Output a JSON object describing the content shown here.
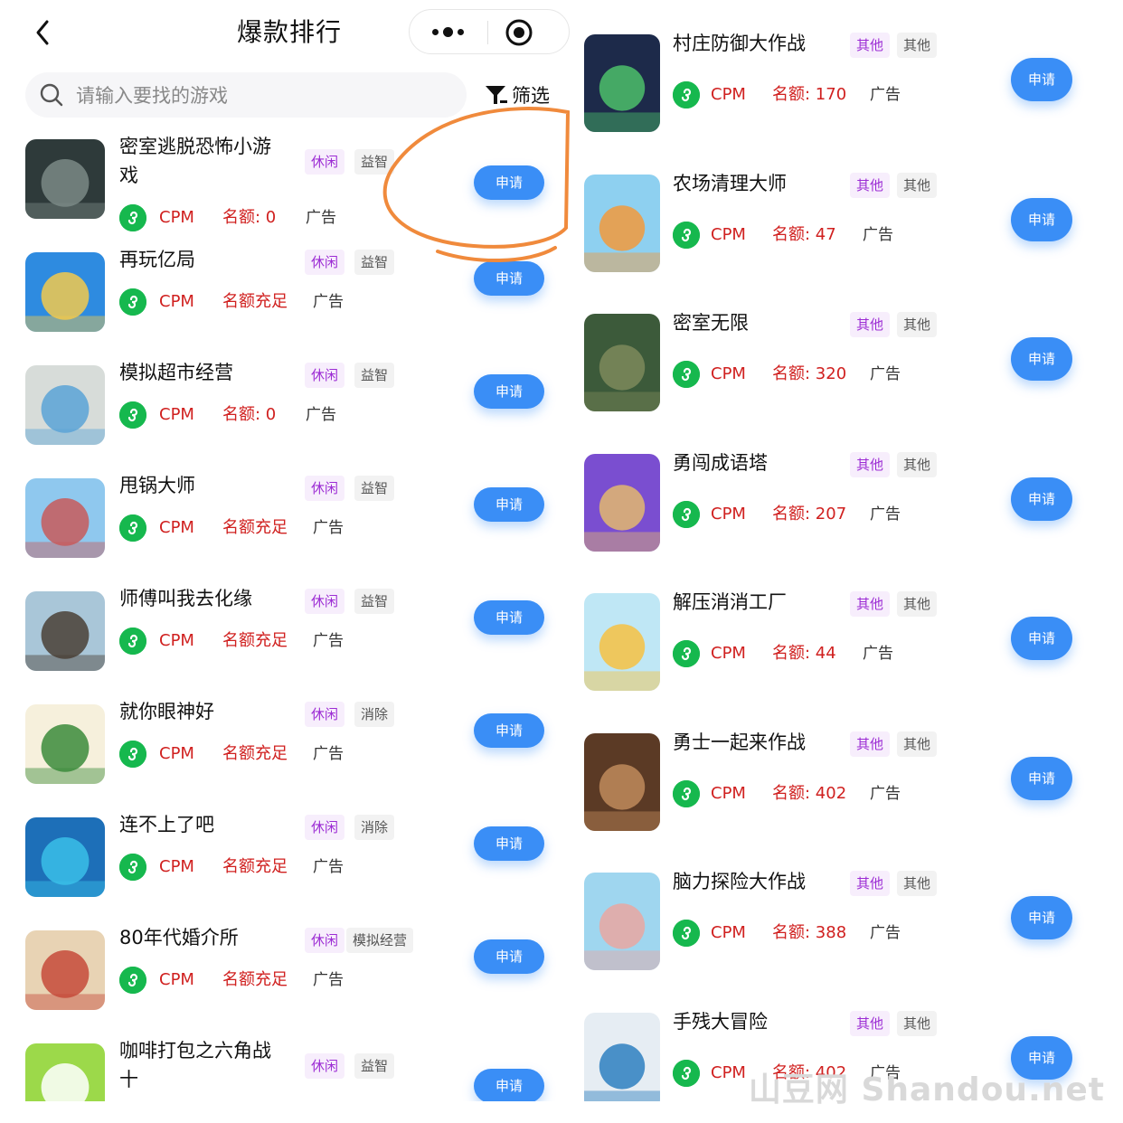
{
  "header": {
    "title": "爆款排行",
    "search_placeholder": "请输入要找的游戏",
    "filter_label": "筛选"
  },
  "apply_label": "申请",
  "left_games": [
    {
      "name_line1": "密室逃脱恐怖小游",
      "name_line2": "戏",
      "tag1": "休闲",
      "tag2": "益智",
      "cpm": "CPM",
      "quota": "名额: 0",
      "ad": "广告",
      "thumb_colors": [
        "#2e3a3a",
        "#7a8a86"
      ]
    },
    {
      "name_line1": "再玩亿局",
      "name_line2": "",
      "tag1": "休闲",
      "tag2": "益智",
      "cpm": "CPM",
      "quota": "名额充足",
      "ad": "广告",
      "thumb_colors": [
        "#2e8be0",
        "#f2c94c"
      ]
    },
    {
      "name_line1": "模拟超市经营",
      "name_line2": "",
      "tag1": "休闲",
      "tag2": "益智",
      "cpm": "CPM",
      "quota": "名额: 0",
      "ad": "广告",
      "thumb_colors": [
        "#d7dcd9",
        "#5aa3d6"
      ]
    },
    {
      "name_line1": "甩锅大师",
      "name_line2": "",
      "tag1": "休闲",
      "tag2": "益智",
      "cpm": "CPM",
      "quota": "名额充足",
      "ad": "广告",
      "thumb_colors": [
        "#8fc8ee",
        "#c85a5a"
      ]
    },
    {
      "name_line1": "师傅叫我去化缘",
      "name_line2": "",
      "tag1": "休闲",
      "tag2": "益智",
      "cpm": "CPM",
      "quota": "名额充足",
      "ad": "广告",
      "thumb_colors": [
        "#a9c6d8",
        "#4a3f36"
      ]
    },
    {
      "name_line1": "就你眼神好",
      "name_line2": "",
      "tag1": "休闲",
      "tag2": "消除",
      "cpm": "CPM",
      "quota": "名额充足",
      "ad": "广告",
      "thumb_colors": [
        "#f6f0dc",
        "#3b8b3b"
      ]
    },
    {
      "name_line1": "连不上了吧",
      "name_line2": "",
      "tag1": "休闲",
      "tag2": "消除",
      "cpm": "CPM",
      "quota": "名额充足",
      "ad": "广告",
      "thumb_colors": [
        "#1d6fb8",
        "#39c0e8"
      ]
    },
    {
      "name_line1": "80年代婚介所",
      "name_line2": "",
      "tag1": "休闲",
      "tag2": "模拟经营",
      "cpm": "CPM",
      "quota": "名额充足",
      "ad": "广告",
      "thumb_colors": [
        "#e8d3b4",
        "#c64a3a"
      ]
    },
    {
      "name_line1": "咖啡打包之六角战",
      "name_line2": "十",
      "tag1": "休闲",
      "tag2": "益智",
      "cpm": "",
      "quota": "",
      "ad": "",
      "thumb_colors": [
        "#9cd94a",
        "#ffffff"
      ]
    }
  ],
  "right_games": [
    {
      "name": "村庄防御大作战",
      "tag1": "其他",
      "tag2": "其他",
      "cpm": "CPM",
      "quota": "名额: 170",
      "ad": "广告",
      "thumb_colors": [
        "#1d2a4a",
        "#4cbf6a"
      ]
    },
    {
      "name": "农场清理大师",
      "tag1": "其他",
      "tag2": "其他",
      "cpm": "CPM",
      "quota": "名额: 47",
      "ad": "广告",
      "thumb_colors": [
        "#8ed0f0",
        "#f29a3c"
      ]
    },
    {
      "name": "密室无限",
      "tag1": "其他",
      "tag2": "其他",
      "cpm": "CPM",
      "quota": "名额: 320",
      "ad": "广告",
      "thumb_colors": [
        "#3c5a3a",
        "#7c8a5c"
      ]
    },
    {
      "name": "勇闯成语塔",
      "tag1": "其他",
      "tag2": "其他",
      "cpm": "CPM",
      "quota": "名额: 207",
      "ad": "广告",
      "thumb_colors": [
        "#7a4ed0",
        "#e3b86e"
      ]
    },
    {
      "name": "解压消消工厂",
      "tag1": "其他",
      "tag2": "其他",
      "cpm": "CPM",
      "quota": "名额: 44",
      "ad": "广告",
      "thumb_colors": [
        "#bfe7f5",
        "#f6c142"
      ]
    },
    {
      "name": "勇士一起来作战",
      "tag1": "其他",
      "tag2": "其他",
      "cpm": "CPM",
      "quota": "名额: 402",
      "ad": "广告",
      "thumb_colors": [
        "#5b3a25",
        "#c08b5c"
      ]
    },
    {
      "name": "脑力探险大作战",
      "tag1": "其他",
      "tag2": "其他",
      "cpm": "CPM",
      "quota": "名额: 388",
      "ad": "广告",
      "thumb_colors": [
        "#9fd6ef",
        "#e9a7a1"
      ]
    },
    {
      "name": "手残大冒险",
      "tag1": "其他",
      "tag2": "其他",
      "cpm": "CPM",
      "quota": "名额: 402",
      "ad": "广告",
      "thumb_colors": [
        "#e6edf3",
        "#2d7fbf"
      ]
    }
  ],
  "watermark": "山豆网 Shandou.net",
  "colors": {
    "accent": "#3a8ef6",
    "quota_red": "#d0201f",
    "tag_purple": "#9c2cd4",
    "mini_program_green": "#16b84e",
    "annotation_orange": "#f08a3c"
  }
}
